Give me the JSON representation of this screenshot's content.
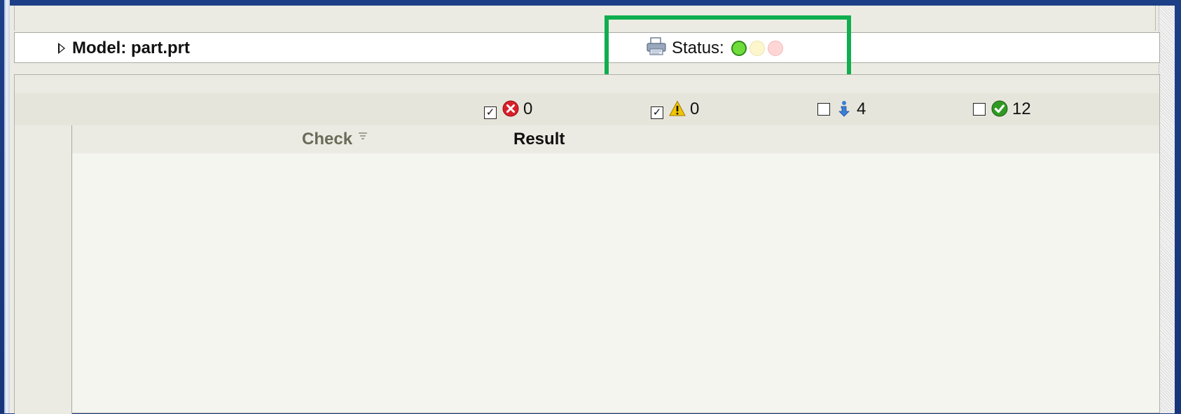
{
  "model": {
    "label": "Model: part.prt"
  },
  "status": {
    "label": "Status:",
    "lights": [
      "green",
      "yellow",
      "red"
    ]
  },
  "filters": [
    {
      "name": "errors",
      "checked": true,
      "icon": "error-icon",
      "count": "0"
    },
    {
      "name": "warnings",
      "checked": true,
      "icon": "warning-icon",
      "count": "0"
    },
    {
      "name": "info",
      "checked": false,
      "icon": "info-icon",
      "count": "4"
    },
    {
      "name": "ok",
      "checked": false,
      "icon": "ok-check-icon",
      "count": "12"
    }
  ],
  "columns": {
    "check": "Check",
    "result": "Result"
  },
  "colors": {
    "highlight": "#0fae4e",
    "status_green": "#6fdc3c",
    "status_yellow": "#fdf6cd",
    "status_red": "#ffd6d6",
    "error": "#d8202a",
    "warning": "#f2c600",
    "info": "#3a7fd6",
    "ok": "#2f9a22"
  }
}
